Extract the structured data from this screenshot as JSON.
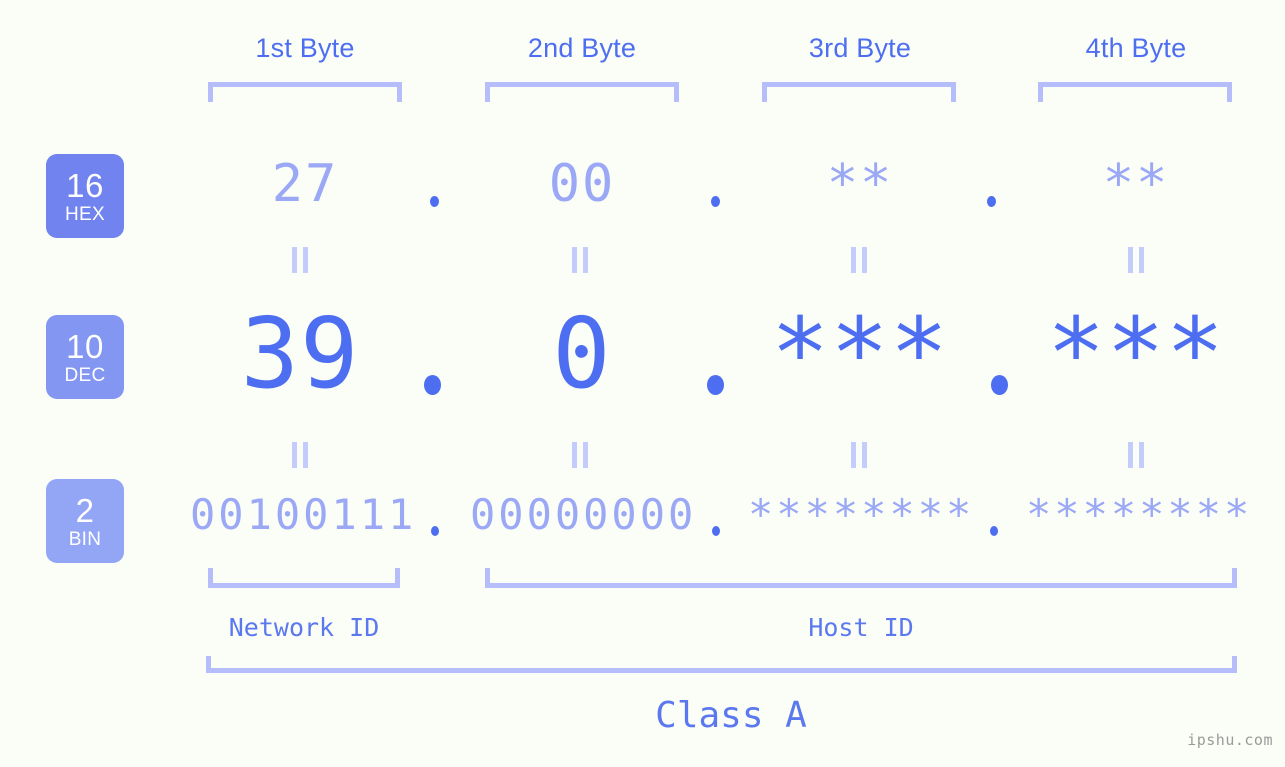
{
  "page": {
    "background_color": "#fbfdf7",
    "accent_color": "#4d6ef0",
    "muted_accent_color": "#9aa8f5",
    "bracket_color": "#b5bdfb",
    "watermark": "ipshu.com"
  },
  "byte_headers": [
    {
      "label": "1st Byte"
    },
    {
      "label": "2nd Byte"
    },
    {
      "label": "3rd Byte"
    },
    {
      "label": "4th Byte"
    }
  ],
  "radix_rows": [
    {
      "number": "16",
      "name": "HEX",
      "color": "#7083ee"
    },
    {
      "number": "10",
      "name": "DEC",
      "color": "#8396f2"
    },
    {
      "number": "2",
      "name": "BIN",
      "color": "#93a6f6"
    }
  ],
  "values": {
    "hex": [
      "27",
      "00",
      "**",
      "**"
    ],
    "dec": [
      "39",
      "0",
      "***",
      "***"
    ],
    "bin": [
      "00100111",
      "00000000",
      "********",
      "********"
    ]
  },
  "separators": {
    "hex": [
      ".",
      ".",
      "."
    ],
    "dec": [
      ".",
      ".",
      "."
    ],
    "bin": [
      ".",
      ".",
      "."
    ]
  },
  "equality_marks": {
    "glyph": "=",
    "count_per_gap": 4,
    "gaps": 2
  },
  "portions": [
    {
      "label": "Network ID"
    },
    {
      "label": "Host ID"
    }
  ],
  "class_label": "Class A"
}
